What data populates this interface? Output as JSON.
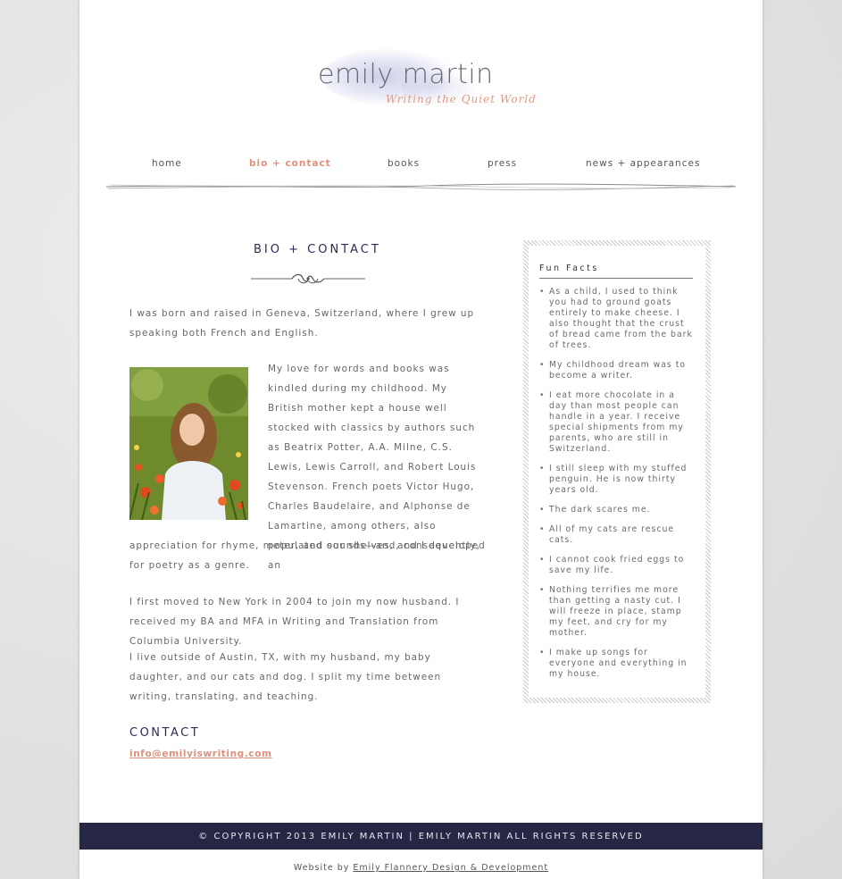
{
  "logo": {
    "name": "emily martin",
    "tagline": "Writing the Quiet World"
  },
  "nav": [
    {
      "label": "home",
      "active": false
    },
    {
      "label": "bio + contact",
      "active": true
    },
    {
      "label": "books",
      "active": false
    },
    {
      "label": "press",
      "active": false
    },
    {
      "label": "news + appearances",
      "active": false
    }
  ],
  "main": {
    "title": "BIO + CONTACT",
    "paragraph_1": "I was born and raised in Geneva, Switzerland, where I grew up speaking both French and English.",
    "paragraph_2a": "My love for words and books was kindled during my childhood. My British mother kept a house well stocked with classics by authors such as Beatrix Potter, A.A. Milne, C.S. Lewis, Lewis Carroll, and Robert Louis Stevenson. French poets Victor Hugo, Charles Baudelaire, and Alphonse de Lamartine, among others, also populated our shelves, and I developed an",
    "paragraph_2b": "appreciation for rhyme, meter, and sounds—and, consequently, for poetry as a genre.",
    "paragraph_3": "I first moved to New York in 2004 to join my now husband. I received my BA and MFA in Writing and Translation from Columbia University.",
    "paragraph_4": "I live outside of Austin, TX, with my husband, my baby daughter, and our cats and dog. I split my time between writing, translating, and teaching.",
    "contact_title": "CONTACT",
    "contact_email": "info@emilyiswriting.com"
  },
  "sidebar": {
    "title": "Fun Facts",
    "facts": [
      "As a child, I used to think you had to ground goats entirely to make cheese. I also thought that the crust of bread came from the bark of trees.",
      "My childhood dream was to become a writer.",
      "I eat more chocolate in a day than most people can handle in a year. I receive special shipments from my parents, who are still in Switzerland.",
      "I still sleep with my stuffed penguin. He is now thirty years old.",
      "The dark scares me.",
      "All of my cats are rescue cats.",
      "I cannot cook fried eggs to save my life.",
      "Nothing terrifies me more than getting a nasty cut. I will freeze in place, stamp my feet, and cry for my mother.",
      "I make up songs for everyone and everything in my house."
    ]
  },
  "footer": {
    "copyright": "© COPYRIGHT 2013 EMILY MARTIN | EMILY MARTIN ALL RIGHTS RESERVED",
    "credit_prefix": "Website by",
    "credit_link": "Emily Flannery Design & Development"
  },
  "colors": {
    "accent": "#e0907a",
    "navy": "#262645",
    "logo_wash": "#b4b6de"
  }
}
